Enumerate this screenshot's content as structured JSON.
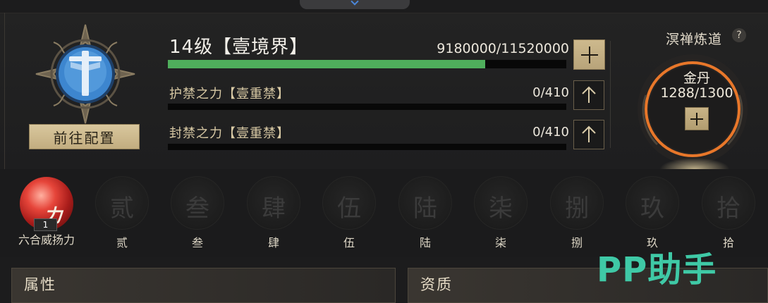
{
  "level": {
    "title": "14级【壹境界】",
    "exp_text": "9180000/11520000",
    "exp_fraction": 0.797
  },
  "goto_button": "前往配置",
  "sub_stats": [
    {
      "label": "护禁之力【壹重禁】",
      "value": "0/410",
      "fraction": 0
    },
    {
      "label": "封禁之力【壹重禁】",
      "value": "0/410",
      "fraction": 0
    }
  ],
  "meditation": {
    "title": "溟禅炼道",
    "help": "?",
    "orb_name": "金丹",
    "orb_value": "1288/1300",
    "ring_color": "#e8772a"
  },
  "skills": [
    {
      "label": "六合威扬力",
      "glyph": "力",
      "badge": "1",
      "active": true
    },
    {
      "label": "贰",
      "glyph": "贰"
    },
    {
      "label": "叁",
      "glyph": "叁"
    },
    {
      "label": "肆",
      "glyph": "肆"
    },
    {
      "label": "伍",
      "glyph": "伍"
    },
    {
      "label": "陆",
      "glyph": "陆"
    },
    {
      "label": "柒",
      "glyph": "柒"
    },
    {
      "label": "捌",
      "glyph": "捌"
    },
    {
      "label": "玖",
      "glyph": "玖"
    },
    {
      "label": "拾",
      "glyph": "拾"
    }
  ],
  "panels": {
    "attributes": "属性",
    "qualification": "资质"
  },
  "watermark": "PP助手",
  "colors": {
    "progress": "#4fae5c",
    "accent_gold": "#c9b487",
    "watermark": "#3fc9a6"
  }
}
